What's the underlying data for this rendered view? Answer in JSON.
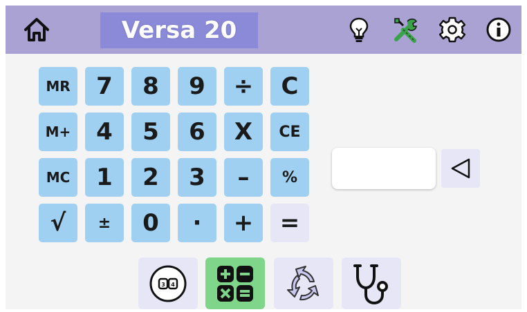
{
  "header": {
    "title": "Versa 20",
    "icons": [
      "home-icon",
      "lightbulb-icon",
      "tools-icon",
      "gear-icon",
      "info-icon"
    ]
  },
  "keypad": {
    "rows": [
      [
        "MR",
        "7",
        "8",
        "9",
        "÷",
        "C"
      ],
      [
        "M+",
        "4",
        "5",
        "6",
        "X",
        "CE"
      ],
      [
        "MC",
        "1",
        "2",
        "3",
        "–",
        "%"
      ],
      [
        "√",
        "±",
        "0",
        "·",
        "+",
        "="
      ]
    ]
  },
  "display": {
    "value": ""
  },
  "bottom_nav": {
    "items": [
      "counter-icon",
      "calculator-icon",
      "recycle-icon",
      "stethoscope-icon"
    ],
    "active": "calculator-icon"
  },
  "colors": {
    "topbar": "#a9a2d3",
    "title_box": "#8b8ad8",
    "key": "#9fd0f2",
    "equals_key": "#e6e6f6",
    "active_nav": "#7fd68a",
    "inactive_nav": "#e6e6f6",
    "background": "#f4f4f4"
  }
}
